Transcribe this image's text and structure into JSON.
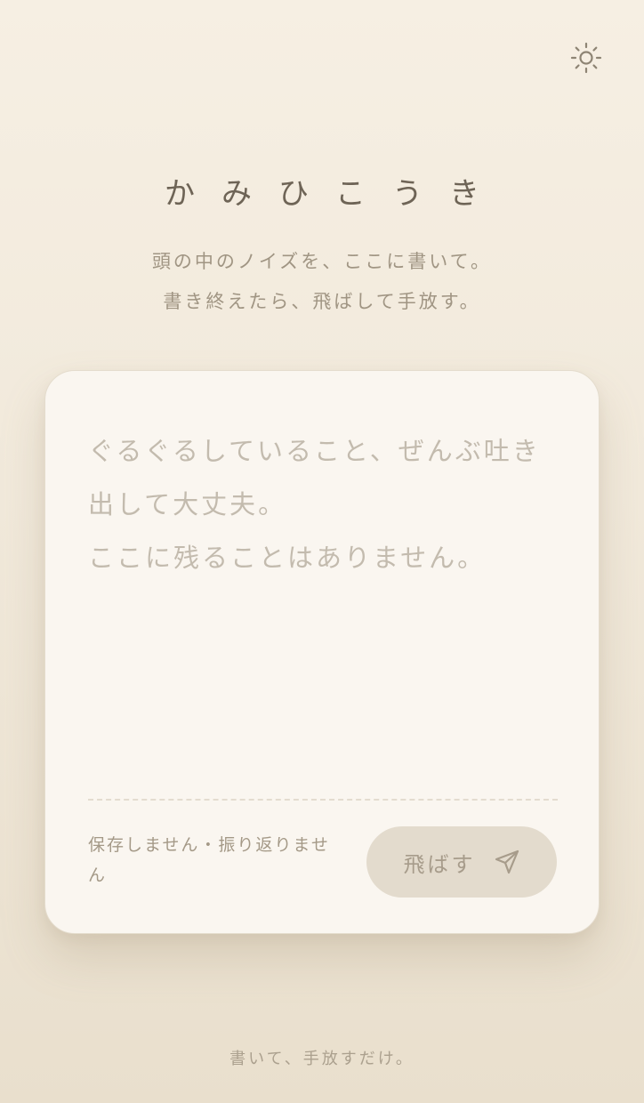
{
  "header": {
    "theme_toggle_icon": "sun-icon",
    "title": "かみひこうき",
    "subtitle_line1": "頭の中のノイズを、ここに書いて。",
    "subtitle_line2": "書き終えたら、飛ばして手放す。"
  },
  "card": {
    "input_value": "",
    "input_placeholder": "ぐるぐるしていること、ぜんぶ吐き出して大丈夫。\nここに残ることはありません。",
    "privacy_note": "保存しません・振り返りません",
    "send_label": "飛ばす",
    "send_icon": "paper-plane-icon"
  },
  "footer": {
    "text": "書いて、手放すだけ。"
  },
  "colors": {
    "background": "#f3ecdf",
    "card": "#faf6f0",
    "button": "#e3dbcd",
    "text": "#8a7f70"
  }
}
